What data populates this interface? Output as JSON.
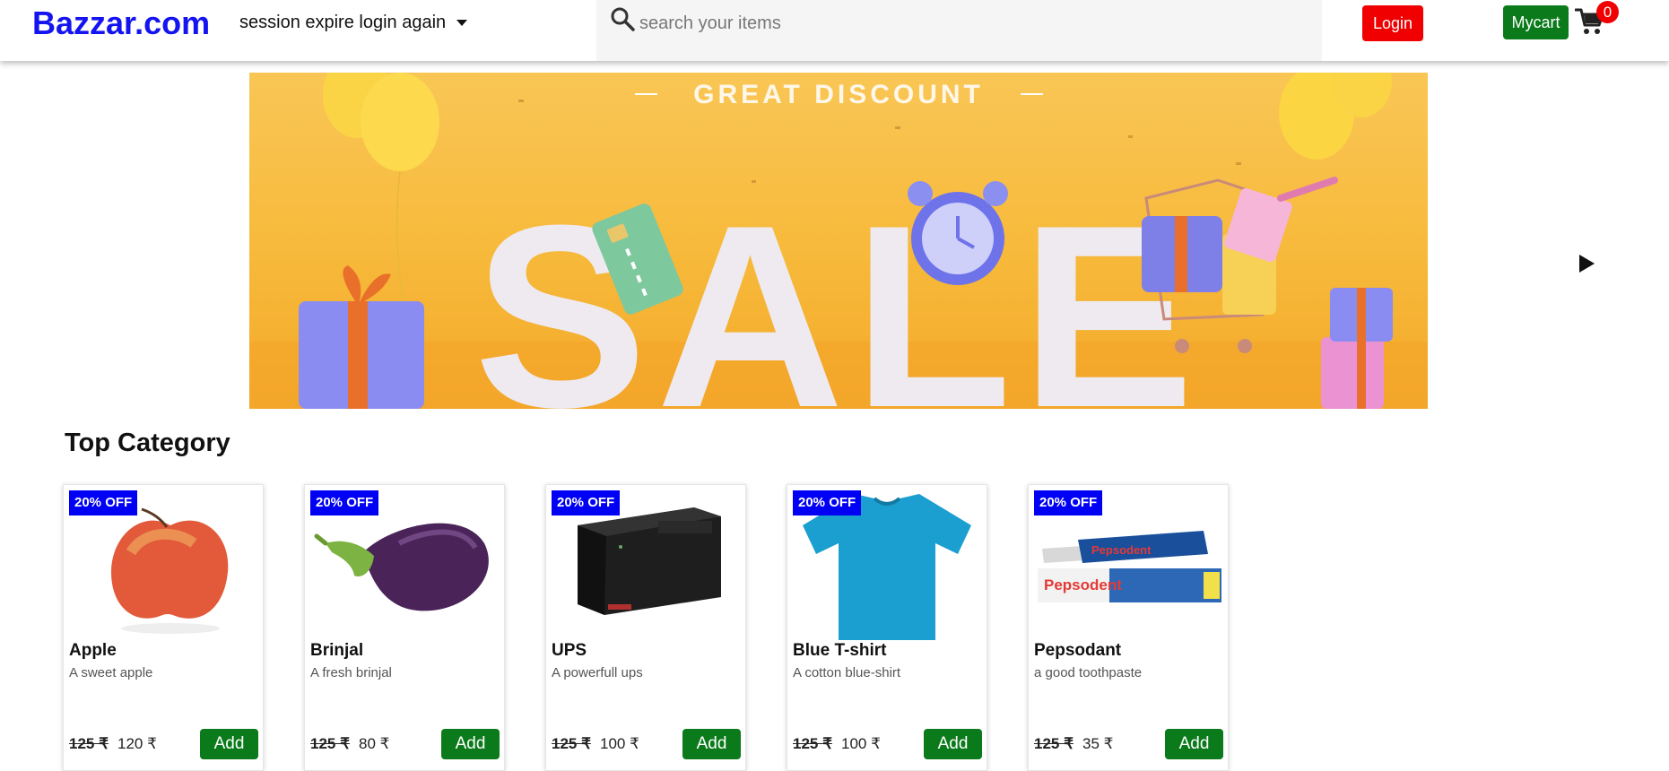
{
  "header": {
    "logo": "Bazzar.com",
    "session_text": "session expire login again",
    "search_placeholder": "search your items",
    "login_label": "Login",
    "mycart_label": "Mycart",
    "cart_count": "0"
  },
  "banner": {
    "headline": "GREAT DISCOUNT",
    "big_text": "SALE"
  },
  "section": {
    "title": "Top Category"
  },
  "products": [
    {
      "badge": "20% OFF",
      "name": "Apple",
      "desc": "A sweet apple",
      "old_price": "125 ₹",
      "new_price": "120 ₹",
      "add_label": "Add"
    },
    {
      "badge": "20% OFF",
      "name": "Brinjal",
      "desc": "A fresh brinjal",
      "old_price": "125 ₹",
      "new_price": "80 ₹",
      "add_label": "Add"
    },
    {
      "badge": "20% OFF",
      "name": "UPS",
      "desc": "A powerfull ups",
      "old_price": "125 ₹",
      "new_price": "100 ₹",
      "add_label": "Add"
    },
    {
      "badge": "20% OFF",
      "name": "Blue T-shirt",
      "desc": "A cotton blue-shirt",
      "old_price": "125 ₹",
      "new_price": "100 ₹",
      "add_label": "Add"
    },
    {
      "badge": "20% OFF",
      "name": "Pepsodant",
      "desc": "a good toothpaste",
      "old_price": "125 ₹",
      "new_price": "35 ₹",
      "add_label": "Add"
    }
  ],
  "product_images": {
    "toothpaste_brand": "Pepsodent"
  },
  "colors": {
    "logo": "#1414f0",
    "login": "#f00000",
    "mycart": "#0a7a1a",
    "badge": "#0000f5",
    "add_button": "#0a7a1a",
    "banner": "#f7b93a"
  },
  "icons": {
    "search": "search-icon",
    "cart": "cart-icon",
    "dropdown": "caret-down-icon",
    "carousel_next": "play-right-icon"
  }
}
